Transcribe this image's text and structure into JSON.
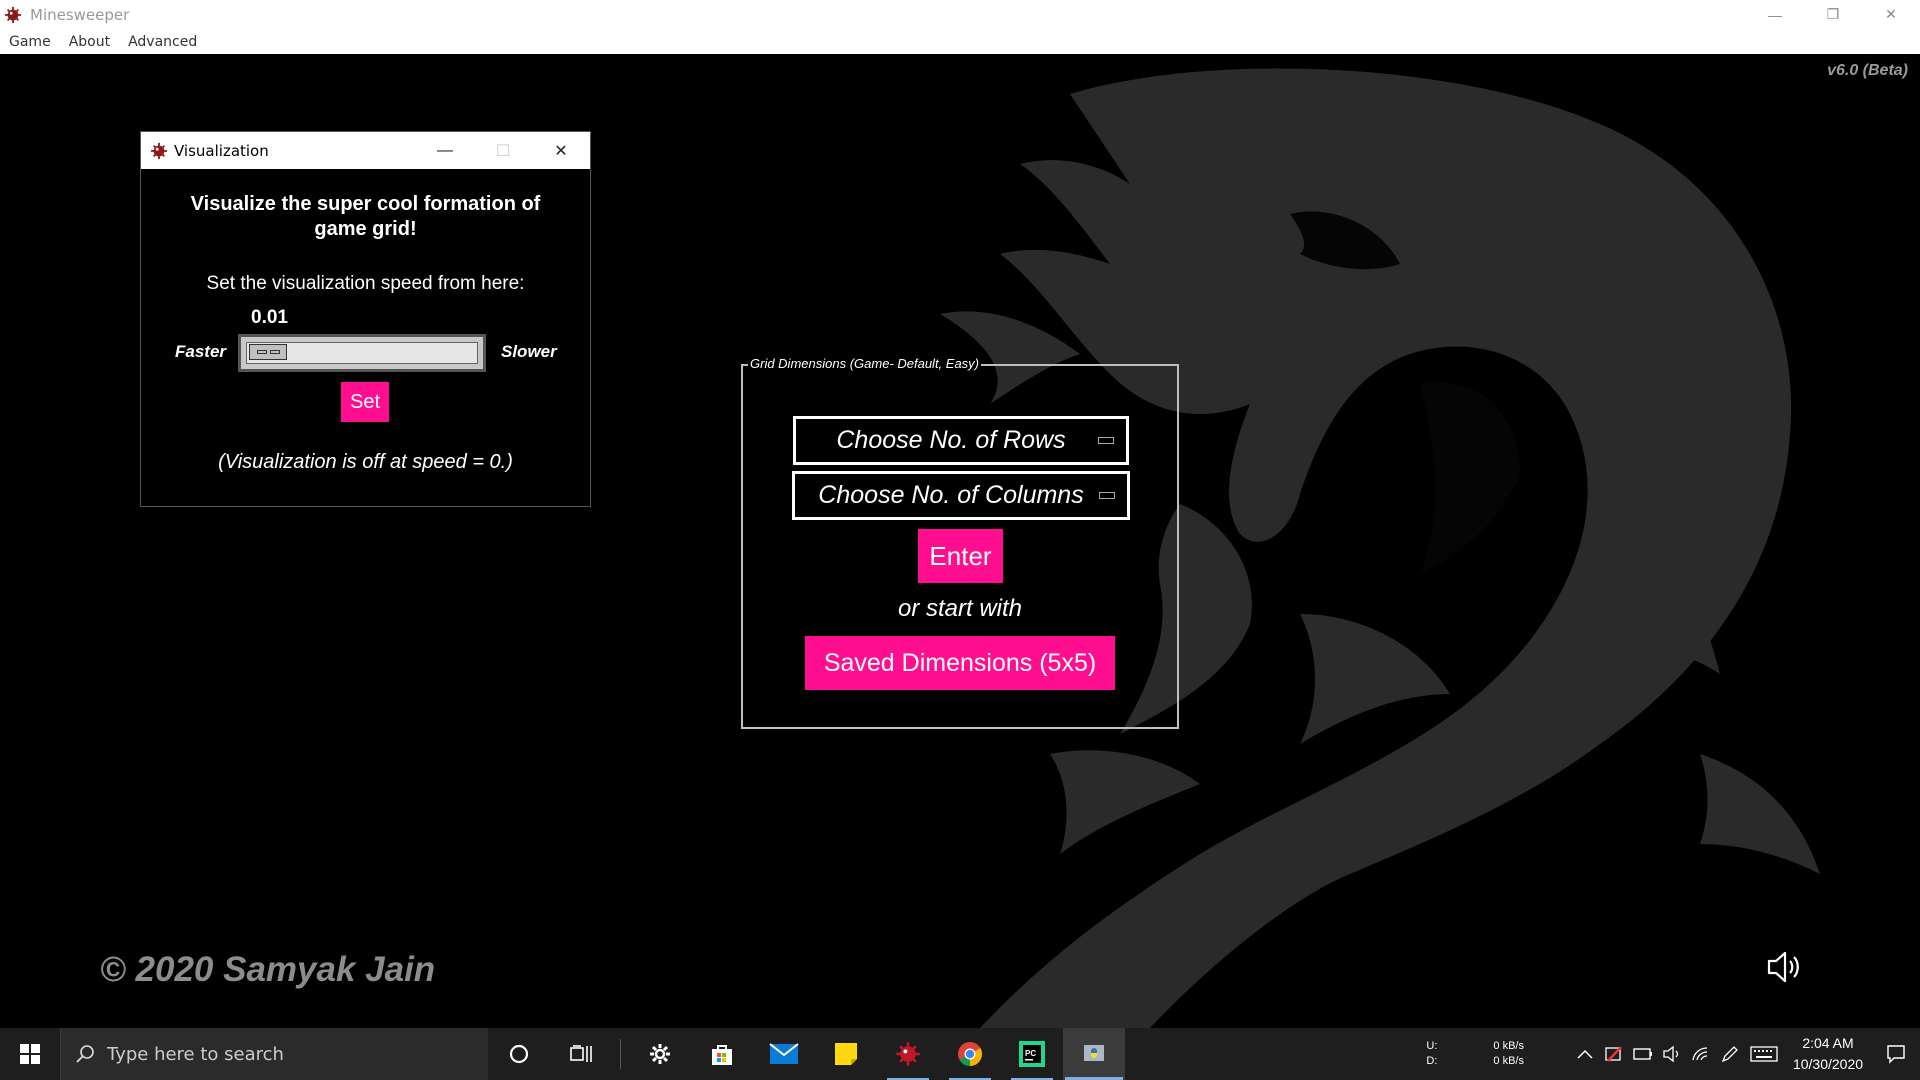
{
  "app": {
    "title": "Minesweeper",
    "version": "v6.0 (Beta)",
    "copyright": "© 2020 Samyak Jain",
    "menu": [
      "Game",
      "About",
      "Advanced"
    ],
    "accent_color": "#ff0f8f"
  },
  "window_controls": {
    "minimize": "—",
    "restore": "❐",
    "close": "✕"
  },
  "visualization": {
    "title": "Visualization",
    "heading": "Visualize the super cool formation of game grid!",
    "subheading": "Set the visualization speed from here:",
    "speed_value": "0.01",
    "faster_label": "Faster",
    "slower_label": "Slower",
    "slider_level": 0.01,
    "set_label": "Set",
    "note": "(Visualization is off at speed = 0.)"
  },
  "grid_dimensions": {
    "legend": "Grid Dimensions (Game- Default, Easy)",
    "rows_selected": "Choose No. of Rows",
    "columns_selected": "Choose No. of Columns",
    "enter_label": "Enter",
    "or_text": "or start with",
    "saved_label": "Saved Dimensions (5x5)"
  },
  "taskbar": {
    "search_placeholder": "Type here to search",
    "icons": [
      "windows-start-icon",
      "cortana-icon",
      "task-view-icon",
      "settings-icon",
      "store-icon",
      "mail-icon",
      "sticky-notes-icon",
      "minesweeper-icon",
      "chrome-icon",
      "pycharm-icon",
      "python-icon"
    ],
    "net_upload_label": "U:",
    "net_download_label": "D:",
    "net_upload_speed": "0 kB/s",
    "net_download_speed": "0 kB/s",
    "time": "2:04 AM",
    "date": "10/30/2020"
  }
}
